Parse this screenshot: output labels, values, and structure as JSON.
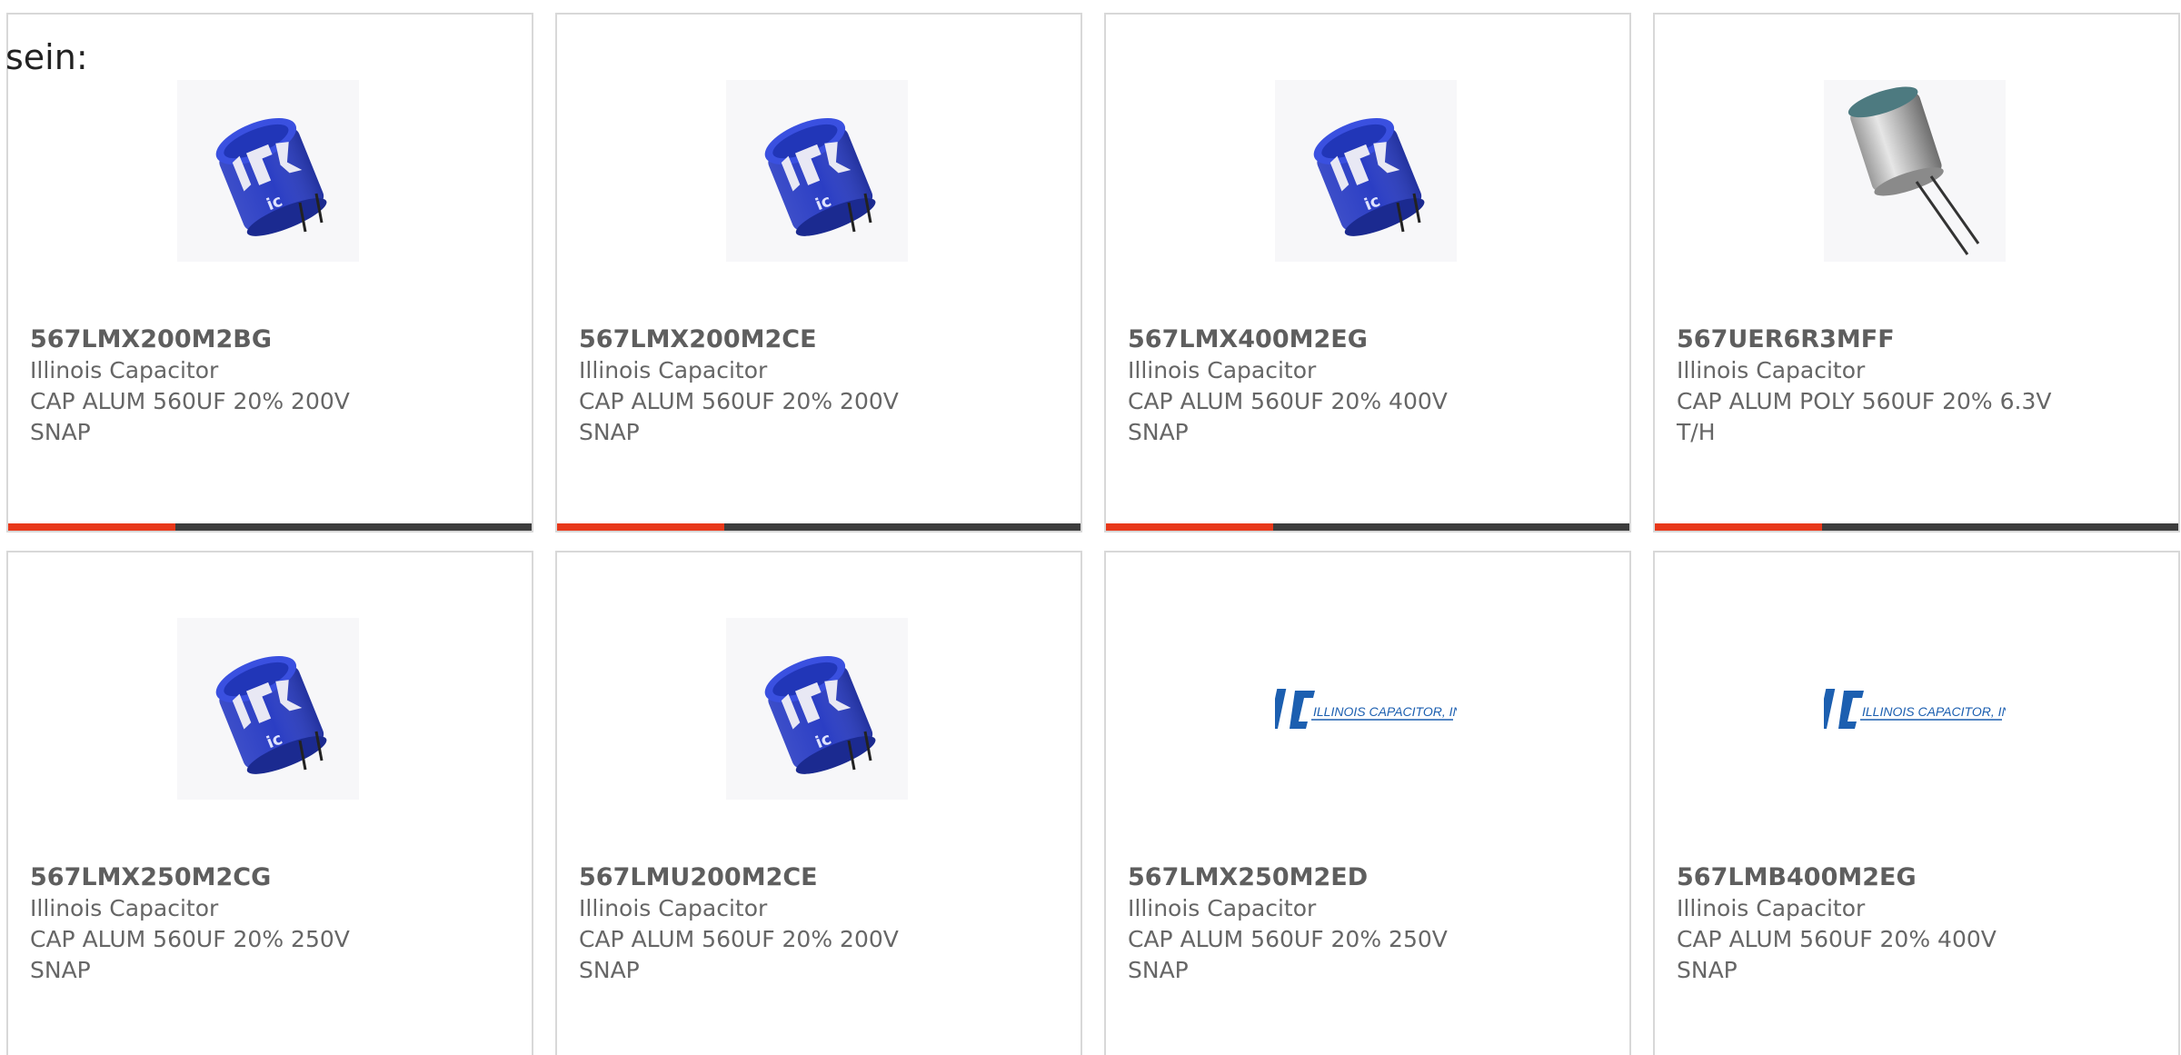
{
  "intro_text": "sein:",
  "accent_color": "#e8381a",
  "bar_color": "#3d3d3d",
  "cards": [
    {
      "part": "567LMX200M2BG",
      "maker": "Illinois Capacitor",
      "desc1": "CAP ALUM 560UF 20% 200V",
      "desc2": "SNAP",
      "image": "blue-snap-capacitor",
      "progress": 0.32
    },
    {
      "part": "567LMX200M2CE",
      "maker": "Illinois Capacitor",
      "desc1": "CAP ALUM 560UF 20% 200V",
      "desc2": "SNAP",
      "image": "blue-snap-capacitor",
      "progress": 0.32
    },
    {
      "part": "567LMX400M2EG",
      "maker": "Illinois Capacitor",
      "desc1": "CAP ALUM 560UF 20% 400V",
      "desc2": "SNAP",
      "image": "blue-snap-capacitor",
      "progress": 0.32
    },
    {
      "part": "567UER6R3MFF",
      "maker": "Illinois Capacitor",
      "desc1": "CAP ALUM POLY 560UF 20% 6.3V",
      "desc2": "T/H",
      "image": "radial-polymer-capacitor",
      "progress": 0.32
    },
    {
      "part": "567LMX250M2CG",
      "maker": "Illinois Capacitor",
      "desc1": "CAP ALUM 560UF 20% 250V",
      "desc2": "SNAP",
      "image": "blue-snap-capacitor"
    },
    {
      "part": "567LMU200M2CE",
      "maker": "Illinois Capacitor",
      "desc1": "CAP ALUM 560UF 20% 200V",
      "desc2": "SNAP",
      "image": "blue-snap-capacitor"
    },
    {
      "part": "567LMX250M2ED",
      "maker": "Illinois Capacitor",
      "desc1": "CAP ALUM 560UF 20% 250V",
      "desc2": "SNAP",
      "image": "illinois-capacitor-logo"
    },
    {
      "part": "567LMB400M2EG",
      "maker": "Illinois Capacitor",
      "desc1": "CAP ALUM 560UF 20% 400V",
      "desc2": "SNAP",
      "image": "illinois-capacitor-logo"
    }
  ],
  "logo_text": "ILLINOIS CAPACITOR, INC."
}
